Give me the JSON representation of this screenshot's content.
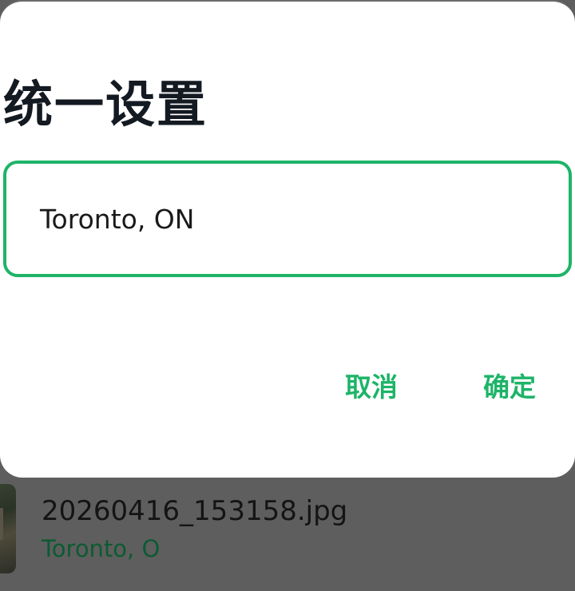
{
  "dialog": {
    "title": "统一设置",
    "input_value": "Toronto, ON",
    "cancel_label": "取消",
    "confirm_label": "确定"
  },
  "background_list": {
    "items": [
      {
        "filename": "20260416_153158.jpg",
        "location": "Toronto, O"
      }
    ]
  },
  "colors": {
    "accent": "#1db468",
    "scrim": "#5e5e5e",
    "title": "#141a22",
    "location_text": "#0d5a32"
  }
}
